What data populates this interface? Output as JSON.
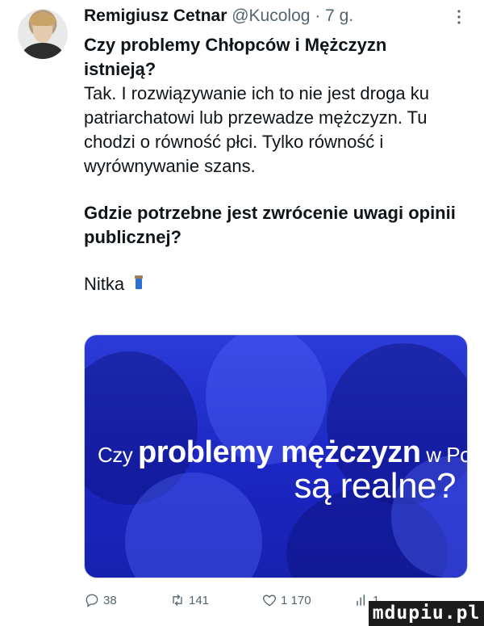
{
  "tweet": {
    "author_name": "Remigiusz Cetnar",
    "handle_meta": "@Kucolog · 7 g.",
    "more_icon": "more-icon",
    "title_bold": "Czy problemy Chłopców i Mężczyzn istnieją?",
    "paragraph": "Tak. I rozwiązywanie ich to nie jest droga ku patriarchatowi lub przewadze mężczyzn. Tu chodzi o równość płci. Tylko równość i wyrównywanie szans.",
    "question_bold": "Gdzie potrzebne jest zwrócenie uwagi opinii publicznej?",
    "thread_label": "Nitka",
    "thread_icon": "spool-of-thread-icon"
  },
  "media": {
    "line1_prefix": "Czy ",
    "line1_bold": "problemy mężczyzn",
    "line1_suffix": " w Polsce",
    "line2": "są realne?",
    "background_color": "#2233cc"
  },
  "actions": {
    "replies": "38",
    "retweets": "141",
    "likes": "1 170",
    "views": "1"
  },
  "watermark": {
    "text": "mdupiu.pl"
  },
  "colors": {
    "text_primary": "#0f1419",
    "text_secondary": "#536471"
  }
}
